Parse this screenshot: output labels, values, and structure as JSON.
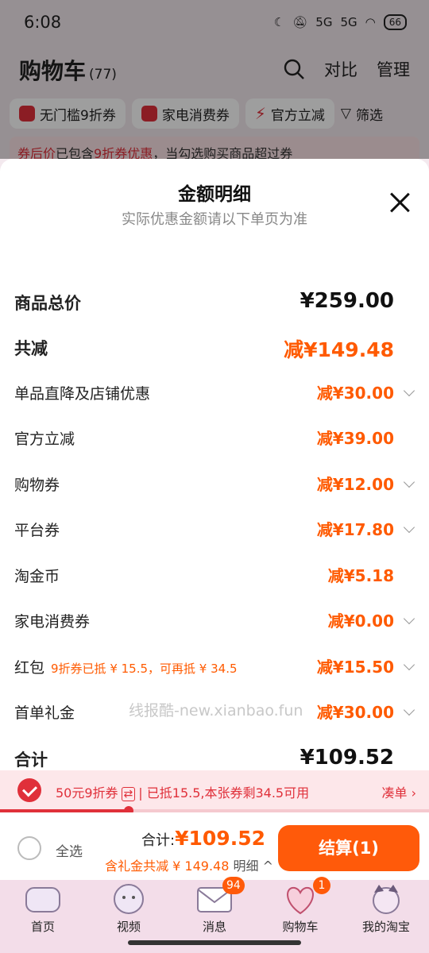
{
  "status": {
    "time": "6:08",
    "signal1": "5G",
    "signal2": "5G",
    "battery": "66"
  },
  "header": {
    "title": "购物车",
    "count": "(77)",
    "compare": "对比",
    "manage": "管理"
  },
  "chips": [
    {
      "label": "无门槛9折券"
    },
    {
      "label": "家电消费券"
    },
    {
      "label": "官方立减"
    },
    {
      "label": "筛选"
    }
  ],
  "notice": {
    "highlight1": "券后价",
    "text1": "已包含",
    "highlight2": "9折券优惠",
    "text2": "，当勾选购买商品超过券"
  },
  "sheet": {
    "title": "金额明细",
    "subtitle": "实际优惠金额请以下单页为准",
    "rows": [
      {
        "label": "商品总价",
        "value": "¥259.00"
      },
      {
        "label": "共减",
        "value": "减¥149.48"
      },
      {
        "label": "单品直降及店铺优惠",
        "value": "减¥30.00"
      },
      {
        "label": "官方立减",
        "value": "减¥39.00"
      },
      {
        "label": "购物券",
        "value": "减¥12.00"
      },
      {
        "label": "平台券",
        "value": "减¥17.80"
      },
      {
        "label": "淘金币",
        "value": "减¥5.18"
      },
      {
        "label": "家电消费券",
        "value": "减¥0.00"
      },
      {
        "label": "红包",
        "sublabel": "9折券已抵 ¥ 15.5，可再抵 ¥ 34.5",
        "value": "减¥15.50"
      },
      {
        "label": "首单礼金",
        "value": "减¥30.00"
      },
      {
        "label": "合计",
        "value": "¥109.52"
      }
    ],
    "watermark": "线报酷-new.xianbao.fun"
  },
  "coupon_bar": {
    "text_a": "50元9折券",
    "swap": "⇄",
    "text_b": "| 已抵15.5,本张券剩34.5可用",
    "link": "凑单 ›"
  },
  "coupon_progress": 0.3,
  "checkout": {
    "select_all": "全选",
    "total_label": "合计:",
    "total_amount": "¥109.52",
    "sub_text": "含礼金共减 ¥ 149.48",
    "detail": "明细 ^",
    "button": "结算(1)"
  },
  "tabs": [
    {
      "label": "首页"
    },
    {
      "label": "视频"
    },
    {
      "label": "消息",
      "badge": "94"
    },
    {
      "label": "购物车",
      "badge": "1"
    },
    {
      "label": "我的淘宝"
    }
  ]
}
